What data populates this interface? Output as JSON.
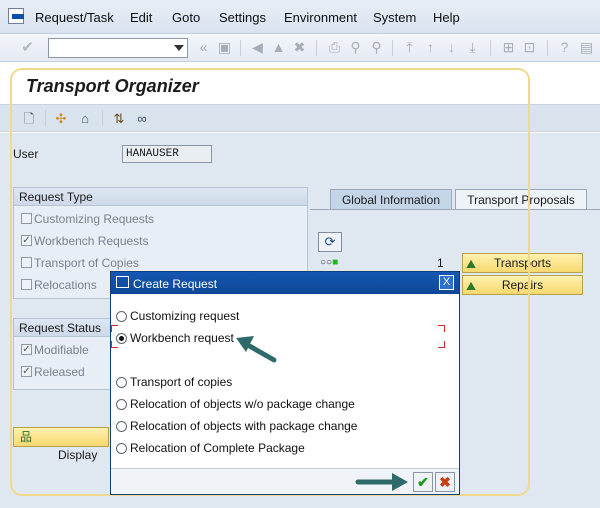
{
  "menu": {
    "items": [
      "Request/Task",
      "Edit",
      "Goto",
      "Settings",
      "Environment",
      "System",
      "Help"
    ]
  },
  "toolbar": {
    "command_value": ""
  },
  "page": {
    "title": "Transport Organizer"
  },
  "user": {
    "label": "User",
    "value": "HANAUSER"
  },
  "request_type": {
    "header": "Request Type",
    "items": [
      "Customizing Requests",
      "Workbench Requests",
      "Transport of Copies",
      "Relocations"
    ]
  },
  "request_status": {
    "header": "Request Status",
    "items": [
      "Modifiable",
      "Released"
    ]
  },
  "display_button": "Display",
  "tabs": {
    "global": "Global Information",
    "proposals": "Transport Proposals"
  },
  "global_info": {
    "count": "1",
    "transports_button": "Transports",
    "repairs_button": "Repairs"
  },
  "dialog": {
    "title": "Create Request",
    "options": [
      "Customizing request",
      "Workbench request",
      "Transport of copies",
      "Relocation of objects w/o package change",
      "Relocation of objects with package change",
      "Relocation of Complete Package"
    ],
    "close_label": "X"
  },
  "colors": {
    "accent": "#0e4796",
    "highlight_frame": "#f0d98a",
    "arrow": "#2e6a6a"
  }
}
